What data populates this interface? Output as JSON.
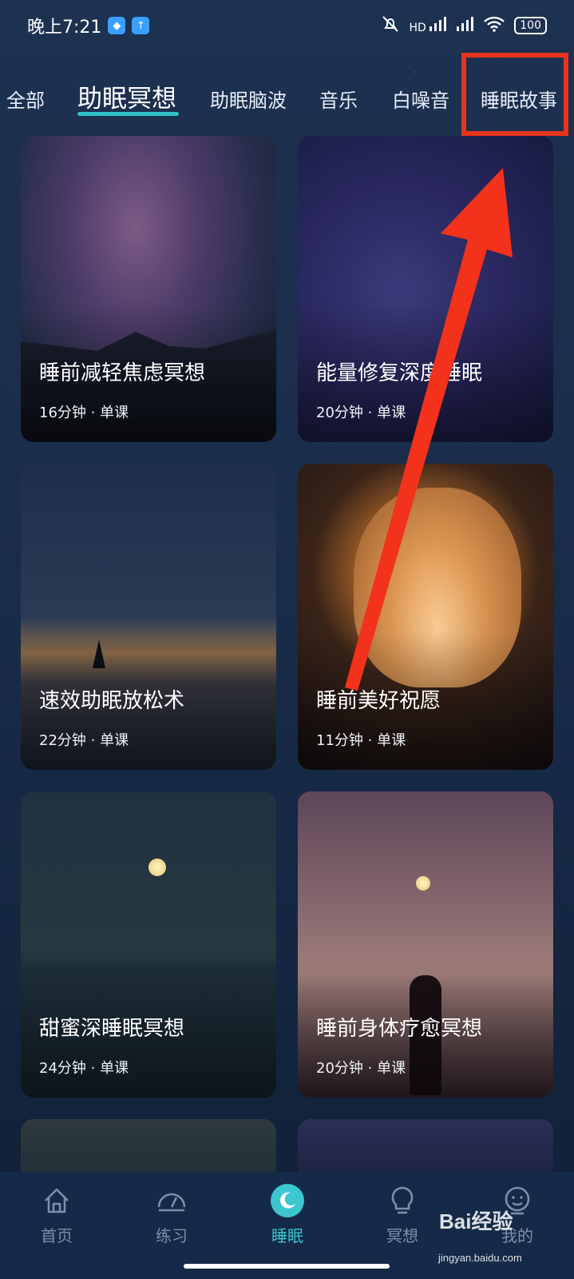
{
  "status_bar": {
    "time": "晚上7:21",
    "signal_label": "HD",
    "battery": "100"
  },
  "tabs": [
    {
      "label": "全部",
      "active": false
    },
    {
      "label": "助眠冥想",
      "active": true
    },
    {
      "label": "助眠脑波",
      "active": false
    },
    {
      "label": "音乐",
      "active": false
    },
    {
      "label": "白噪音",
      "active": false
    },
    {
      "label": "睡眠故事",
      "active": false
    }
  ],
  "cards": [
    {
      "title": "睡前减轻焦虑冥想",
      "meta": "16分钟 · 单课"
    },
    {
      "title": "能量修复深度睡眠",
      "meta": "20分钟 · 单课"
    },
    {
      "title": "速效助眠放松术",
      "meta": "22分钟 · 单课"
    },
    {
      "title": "睡前美好祝愿",
      "meta": "11分钟 · 单课"
    },
    {
      "title": "甜蜜深睡眠冥想",
      "meta": "24分钟 · 单课"
    },
    {
      "title": "睡前身体疗愈冥想",
      "meta": "20分钟 · 单课"
    }
  ],
  "bottom_nav": [
    {
      "label": "首页",
      "icon": "home-icon",
      "active": false
    },
    {
      "label": "练习",
      "icon": "gauge-icon",
      "active": false
    },
    {
      "label": "睡眠",
      "icon": "moon-icon",
      "active": true
    },
    {
      "label": "冥想",
      "icon": "lightbulb-icon",
      "active": false
    },
    {
      "label": "我的",
      "icon": "profile-icon",
      "active": false
    }
  ],
  "watermark": {
    "brand": "Bai经验",
    "url": "jingyan.baidu.com"
  },
  "colors": {
    "accent": "#31c2c9",
    "annotation": "#e8331d"
  }
}
